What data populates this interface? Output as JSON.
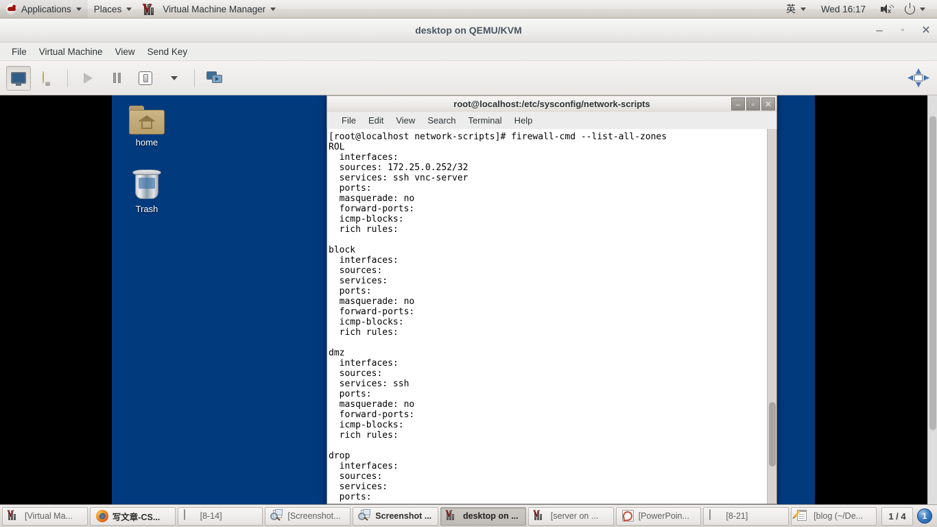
{
  "gnome_panel": {
    "applications_label": "Applications",
    "places_label": "Places",
    "window_menu_label": "Virtual Machine Manager",
    "ime_label": "英",
    "clock": "Wed 16:17",
    "icons": {
      "redhat": "redhat-logo-icon",
      "vmm": "virtual-machine-manager-icon",
      "volume": "volume-muted-icon",
      "power": "power-icon"
    }
  },
  "vmm_window": {
    "title": "desktop on QEMU/KVM",
    "window_buttons": {
      "minimize": "–",
      "maximize": "▫",
      "close": "✕"
    },
    "menus": [
      "File",
      "Virtual Machine",
      "View",
      "Send Key"
    ],
    "toolbar": [
      {
        "name": "console-view-button",
        "icon": "monitor-icon",
        "active": true
      },
      {
        "name": "details-view-button",
        "icon": "lightbulb-icon",
        "active": false
      },
      {
        "name": "run-button",
        "icon": "play-icon",
        "active": false
      },
      {
        "name": "pause-button",
        "icon": "pause-icon",
        "active": false
      },
      {
        "name": "shutdown-button",
        "icon": "shutdown-icon",
        "active": false
      },
      {
        "name": "shutdown-menu-button",
        "icon": "chevron-down-icon",
        "active": false
      },
      {
        "name": "snapshots-button",
        "icon": "screens-icon",
        "active": false
      },
      {
        "name": "resize-to-vm-button",
        "icon": "resize-icon",
        "active": false
      }
    ]
  },
  "vm_desktop": {
    "icons": [
      {
        "name": "desktop-icon-home",
        "label": "home",
        "glyph": "folder-home-icon"
      },
      {
        "name": "desktop-icon-trash",
        "label": "Trash",
        "glyph": "trash-icon"
      }
    ],
    "background_color": "#023a7e"
  },
  "terminal": {
    "title": "root@localhost:/etc/sysconfig/network-scripts",
    "menus": [
      "File",
      "Edit",
      "View",
      "Search",
      "Terminal",
      "Help"
    ],
    "window_buttons": {
      "minimize": "–",
      "maximize": "▫",
      "close": "✕"
    },
    "prompt": "[root@localhost network-scripts]#",
    "command": "firewall-cmd --list-all-zones",
    "content": "[root@localhost network-scripts]# firewall-cmd --list-all-zones\nROL\n  interfaces:\n  sources: 172.25.0.252/32\n  services: ssh vnc-server\n  ports:\n  masquerade: no\n  forward-ports:\n  icmp-blocks:\n  rich rules:\n\nblock\n  interfaces:\n  sources:\n  services:\n  ports:\n  masquerade: no\n  forward-ports:\n  icmp-blocks:\n  rich rules:\n\ndmz\n  interfaces:\n  sources:\n  services: ssh\n  ports:\n  masquerade: no\n  forward-ports:\n  icmp-blocks:\n  rich rules:\n\ndrop\n  interfaces:\n  sources:\n  services:\n  ports:",
    "zones": [
      {
        "name": "ROL",
        "interfaces": "",
        "sources": "172.25.0.252/32",
        "services": "ssh vnc-server",
        "ports": "",
        "masquerade": "no",
        "forward_ports": "",
        "icmp_blocks": "",
        "rich_rules": ""
      },
      {
        "name": "block",
        "interfaces": "",
        "sources": "",
        "services": "",
        "ports": "",
        "masquerade": "no",
        "forward_ports": "",
        "icmp_blocks": "",
        "rich_rules": ""
      },
      {
        "name": "dmz",
        "interfaces": "",
        "sources": "",
        "services": "ssh",
        "ports": "",
        "masquerade": "no",
        "forward_ports": "",
        "icmp_blocks": "",
        "rich_rules": ""
      },
      {
        "name": "drop",
        "interfaces": "",
        "sources": "",
        "services": "",
        "ports": ""
      }
    ]
  },
  "taskbar": {
    "buttons": [
      {
        "name": "taskbar-item-virtual-machine-manager",
        "label": "[Virtual Ma...",
        "icon": "vmm-icon",
        "state": "normal"
      },
      {
        "name": "taskbar-item-firefox",
        "label": "写文章-CS...",
        "icon": "firefox-icon",
        "state": "semi"
      },
      {
        "name": "taskbar-item-8-14",
        "label": "[8-14]",
        "icon": "file-icon",
        "state": "normal"
      },
      {
        "name": "taskbar-item-screenshot-1",
        "label": "[Screenshot...",
        "icon": "screenshot-icon",
        "state": "normal"
      },
      {
        "name": "taskbar-item-screenshot-2",
        "label": "Screenshot ...",
        "icon": "screenshot-icon",
        "state": "semi"
      },
      {
        "name": "taskbar-item-desktop-on",
        "label": "desktop on ...",
        "icon": "vmm-icon",
        "state": "active"
      },
      {
        "name": "taskbar-item-server-on",
        "label": "[server on ...",
        "icon": "vmm-icon",
        "state": "normal"
      },
      {
        "name": "taskbar-item-powerpoint",
        "label": "[PowerPoin...",
        "icon": "powerpoint-icon",
        "state": "normal"
      },
      {
        "name": "taskbar-item-8-21",
        "label": "[8-21]",
        "icon": "file-icon",
        "state": "normal"
      },
      {
        "name": "taskbar-item-blog",
        "label": "[blog (~/De...",
        "icon": "notes-icon",
        "state": "normal"
      }
    ],
    "pager_label": "1 / 4",
    "workspace_badge": "1"
  }
}
